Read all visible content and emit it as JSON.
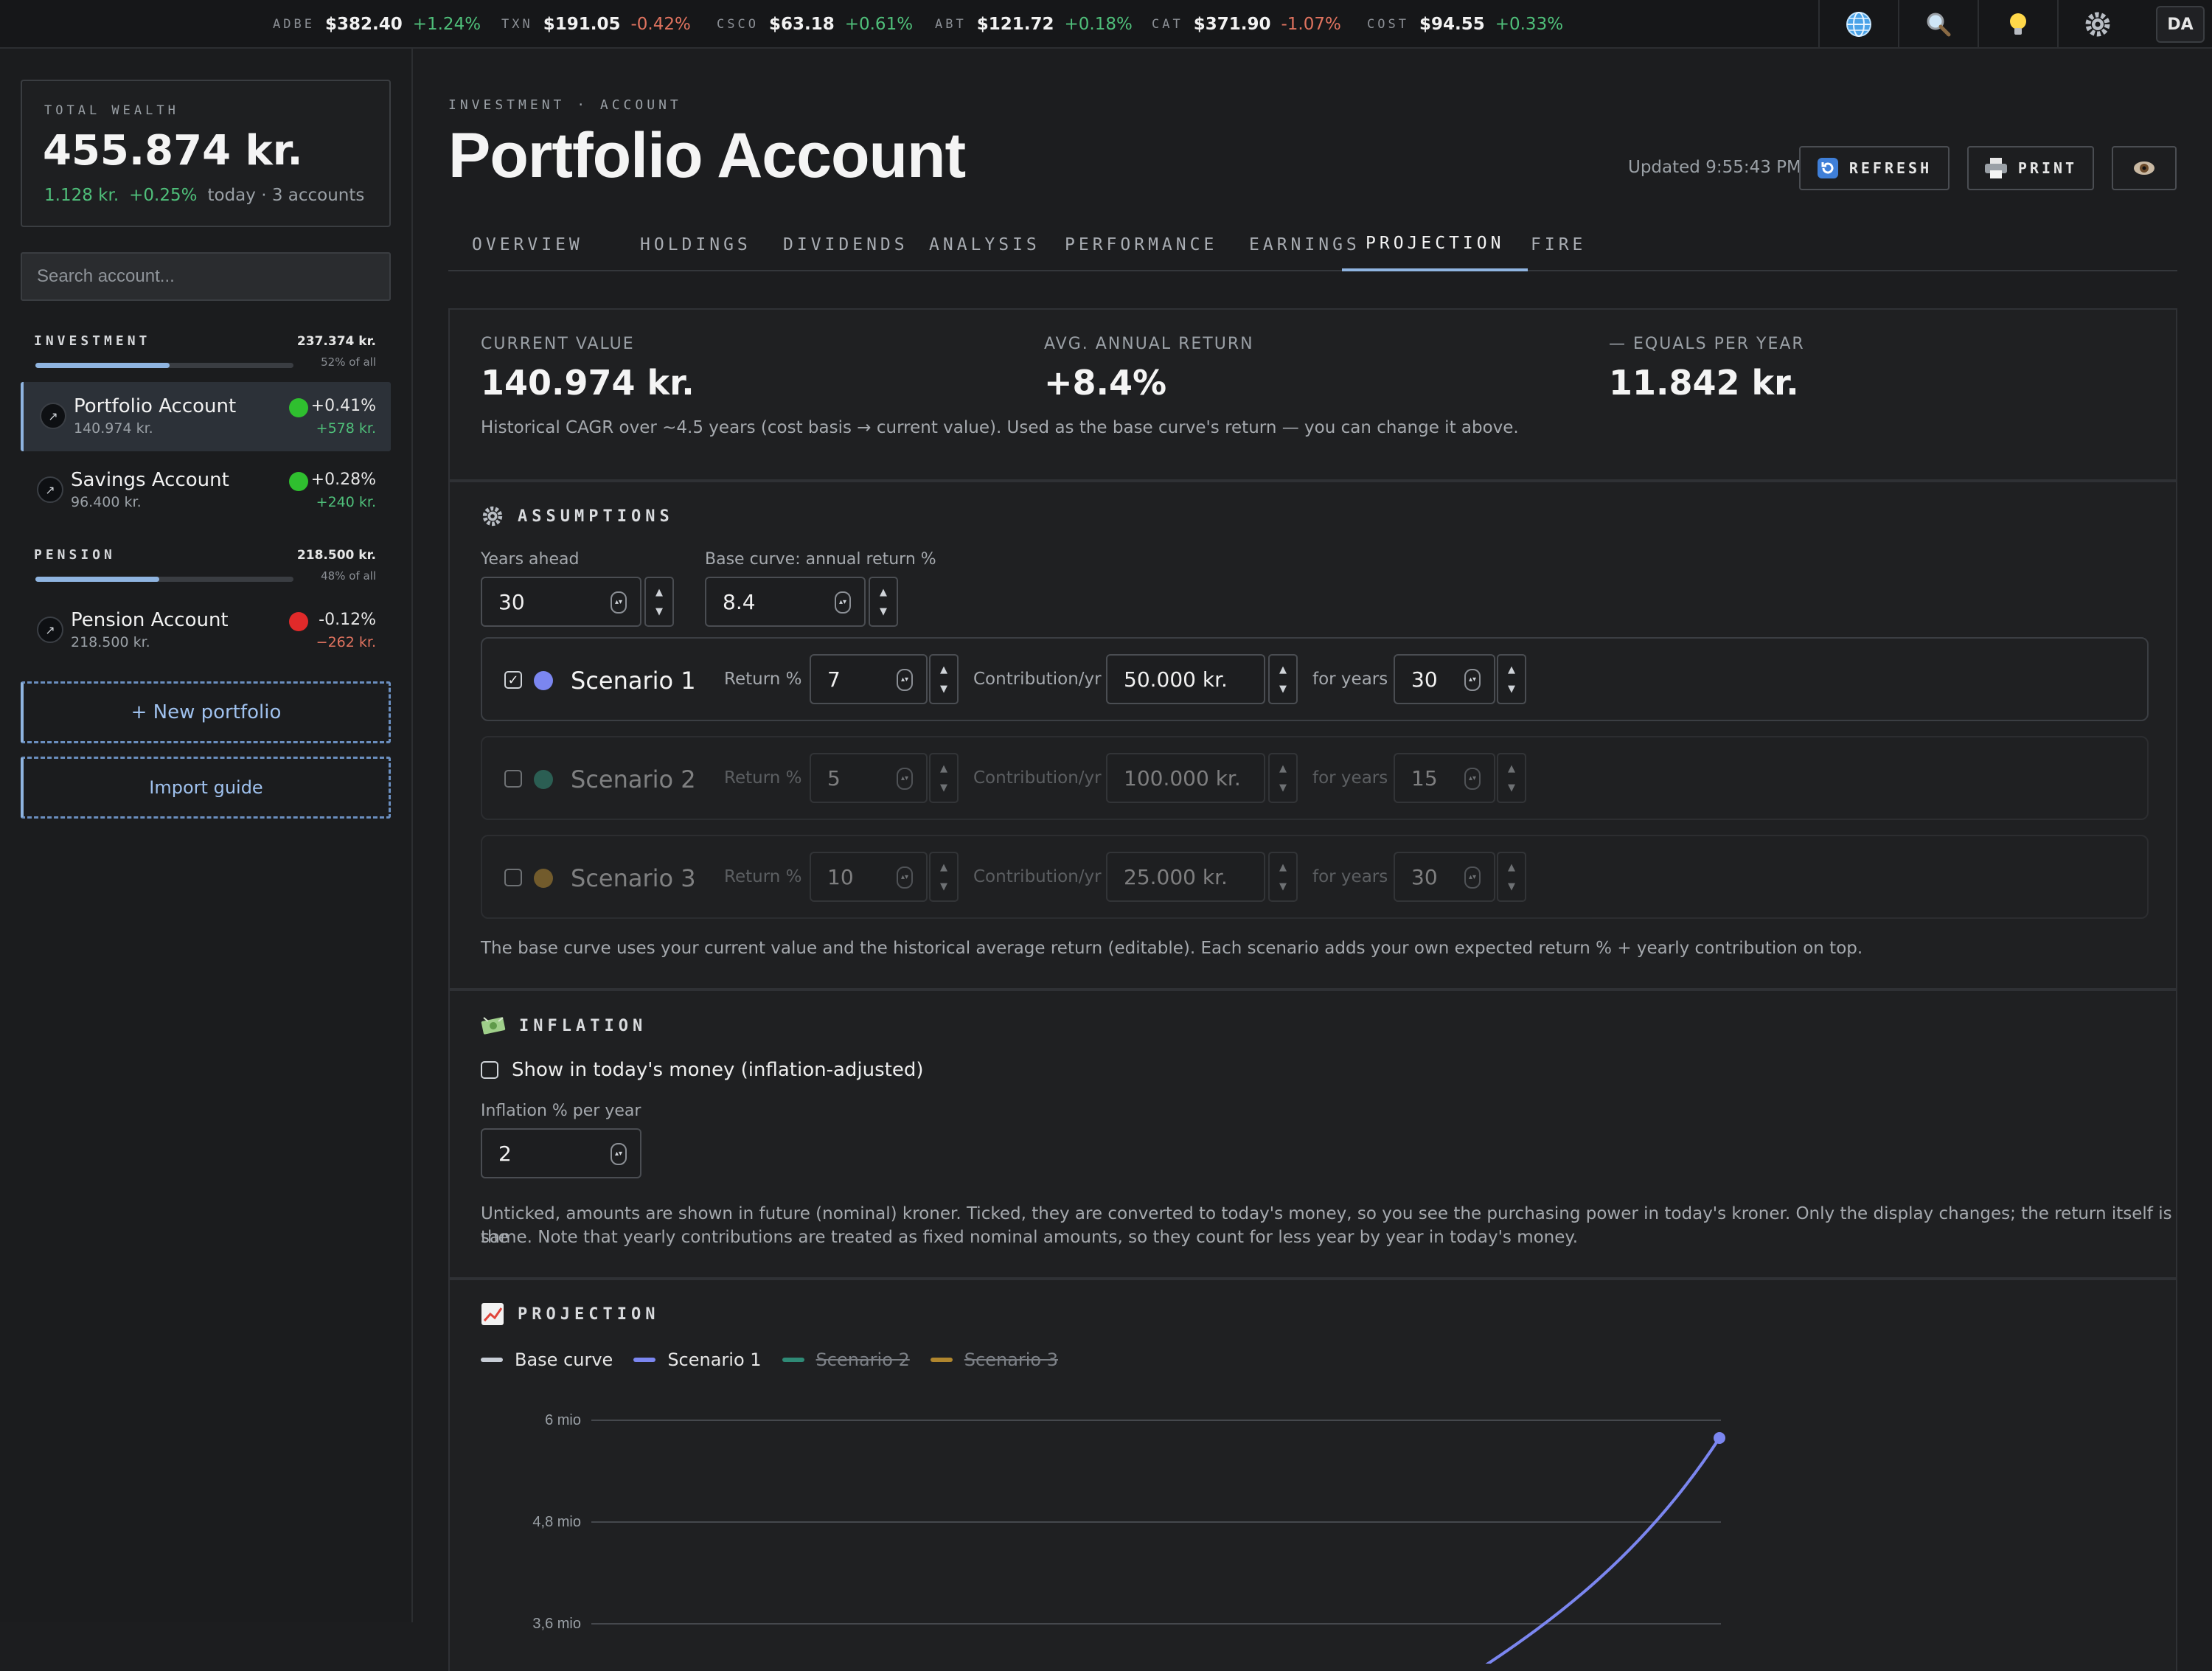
{
  "ticker": [
    {
      "sym": "ADBE",
      "price": "$382.40",
      "chg": "+1.24%",
      "dir": "up"
    },
    {
      "sym": "TXN",
      "price": "$191.05",
      "chg": "-0.42%",
      "dir": "dn"
    },
    {
      "sym": "CSCO",
      "price": "$63.18",
      "chg": "+0.61%",
      "dir": "up"
    },
    {
      "sym": "ABT",
      "price": "$121.72",
      "chg": "+0.18%",
      "dir": "up"
    },
    {
      "sym": "CAT",
      "price": "$371.90",
      "chg": "-1.07%",
      "dir": "dn"
    },
    {
      "sym": "COST",
      "price": "$94.55",
      "chg": "+0.33%",
      "dir": "up"
    }
  ],
  "topbar": {
    "avatar": "DA",
    "icons": [
      "globe-icon",
      "search-icon",
      "lightbulb-icon",
      "gear-icon"
    ]
  },
  "sidebar": {
    "wealth": {
      "label": "TOTAL WEALTH",
      "value": "455.874 kr.",
      "abs": "1.128 kr.",
      "pct": "+0.25%",
      "meta": "today · 3 accounts"
    },
    "search_placeholder": "Search account...",
    "groups": [
      {
        "name": "INVESTMENT",
        "value": "237.374 kr.",
        "share": "52% of all",
        "share_frac": 0.52,
        "accounts": [
          {
            "name": "Portfolio Account",
            "value": "140.974 kr.",
            "pct": "+0.41%",
            "abs": "+578 kr.",
            "status": "up",
            "selected": true
          },
          {
            "name": "Savings Account",
            "value": "96.400 kr.",
            "pct": "+0.28%",
            "abs": "+240 kr.",
            "status": "up",
            "selected": false
          }
        ]
      },
      {
        "name": "PENSION",
        "value": "218.500 kr.",
        "share": "48% of all",
        "share_frac": 0.48,
        "accounts": [
          {
            "name": "Pension Account",
            "value": "218.500 kr.",
            "pct": "-0.12%",
            "abs": "−262 kr.",
            "status": "dn",
            "selected": false
          }
        ]
      }
    ],
    "new_portfolio": "+ New portfolio",
    "import_guide": "Import guide"
  },
  "header": {
    "crumb": "INVESTMENT · ACCOUNT",
    "title": "Portfolio Account",
    "updated": "Updated 9:55:43 PM",
    "refresh": "REFRESH",
    "print": "PRINT"
  },
  "tabs": [
    "OVERVIEW",
    "HOLDINGS",
    "DIVIDENDS",
    "ANALYSIS",
    "PERFORMANCE",
    "EARNINGS",
    "PROJECTION",
    "FIRE"
  ],
  "active_tab": "PROJECTION",
  "summary": {
    "current_label": "CURRENT VALUE",
    "current_value": "140.974 kr.",
    "return_label": "AVG. ANNUAL RETURN",
    "return_value": "+8.4%",
    "equals_label": "— EQUALS PER YEAR",
    "equals_value": "11.842 kr.",
    "note": "Historical CAGR over ~4.5 years (cost basis → current value). Used as the base curve's return — you can change it above."
  },
  "assumptions": {
    "title": "ASSUMPTIONS",
    "years_label": "Years ahead",
    "years": "30",
    "base_label": "Base curve: annual return %",
    "base": "8.4",
    "scenarios": [
      {
        "name": "Scenario 1",
        "checked": true,
        "color": "#7b86f0",
        "return": "7",
        "contribution": "50.000 kr.",
        "years": "30"
      },
      {
        "name": "Scenario 2",
        "checked": false,
        "color": "#3aa98f",
        "return": "5",
        "contribution": "100.000 kr.",
        "years": "15"
      },
      {
        "name": "Scenario 3",
        "checked": false,
        "color": "#d8a43a",
        "return": "10",
        "contribution": "25.000 kr.",
        "years": "30"
      }
    ],
    "return_lbl": "Return %",
    "contrib_lbl": "Contribution/yr",
    "for_years_lbl": "for years",
    "note": "The base curve uses your current value and the historical average return (editable). Each scenario adds your own expected return % + yearly contribution on top."
  },
  "inflation": {
    "title": "INFLATION",
    "toggle": "Show in today's money (inflation-adjusted)",
    "rate_label": "Inflation % per year",
    "rate": "2",
    "note1": "Unticked, amounts are shown in future (nominal) kroner. Ticked, they are converted to today's money, so you see the purchasing power in today's kroner. Only the display changes; the return itself is the",
    "note2": "same. Note that yearly contributions are treated as fixed nominal amounts, so they count for less year by year in today's money."
  },
  "projection": {
    "title": "PROJECTION"
  },
  "chart_data": {
    "type": "line",
    "series": [
      {
        "name": "Base curve",
        "color": "#c7cdd6",
        "visible": true
      },
      {
        "name": "Scenario 1",
        "color": "#7b86f0",
        "visible": true
      },
      {
        "name": "Scenario 2",
        "color": "#2f8a76",
        "visible": false
      },
      {
        "name": "Scenario 3",
        "color": "#b0862e",
        "visible": false
      }
    ],
    "yticks": [
      "6 mio",
      "4,8 mio",
      "3,6 mio"
    ],
    "ylim_visible": [
      3600000,
      6000000
    ]
  }
}
